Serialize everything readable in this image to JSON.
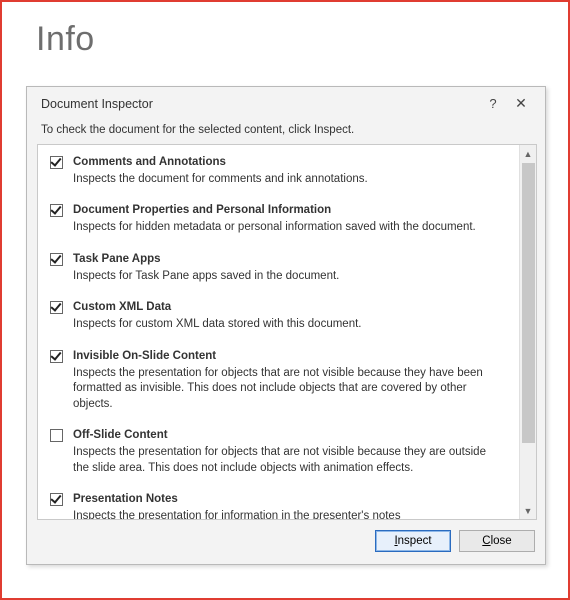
{
  "page_title": "Info",
  "dialog": {
    "title": "Document Inspector",
    "help": "?",
    "close": "✕",
    "instruction": "To check the document for the selected content, click Inspect.",
    "items": [
      {
        "checked": true,
        "title": "Comments and Annotations",
        "desc": "Inspects the document for comments and ink annotations."
      },
      {
        "checked": true,
        "title": "Document Properties and Personal Information",
        "desc": "Inspects for hidden metadata or personal information saved with the document."
      },
      {
        "checked": true,
        "title": "Task Pane Apps",
        "desc": "Inspects for Task Pane apps saved in the document."
      },
      {
        "checked": true,
        "title": "Custom XML Data",
        "desc": "Inspects for custom XML data stored with this document."
      },
      {
        "checked": true,
        "title": "Invisible On-Slide Content",
        "desc": "Inspects the presentation for objects that are not visible because they have been formatted as invisible. This does not include objects that are covered by other objects."
      },
      {
        "checked": false,
        "title": "Off-Slide Content",
        "desc": "Inspects the presentation for objects that are not visible because they are outside the slide area.  This does not include objects with animation effects."
      },
      {
        "checked": true,
        "title": "Presentation Notes",
        "desc": "Inspects the presentation for information in the presenter's notes"
      }
    ],
    "buttons": {
      "inspect": "Inspect",
      "close_btn": "Close"
    }
  }
}
